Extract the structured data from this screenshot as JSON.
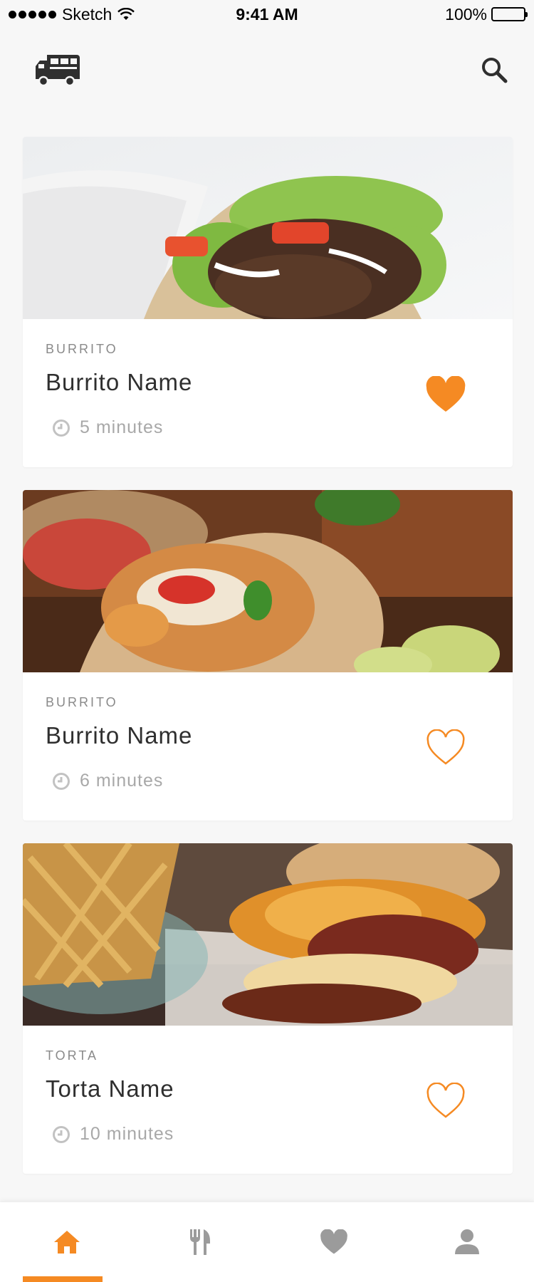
{
  "status_bar": {
    "carrier": "Sketch",
    "time": "9:41 AM",
    "battery": "100%"
  },
  "header": {
    "logo_icon": "food-truck-icon",
    "search_icon": "search-icon"
  },
  "colors": {
    "accent": "#f58a23",
    "tab_inactive": "#9b9b9b",
    "background": "#f7f7f7"
  },
  "cards": [
    {
      "category": "BURRITO",
      "title": "Burrito Name",
      "time": "5 minutes",
      "favorited": true
    },
    {
      "category": "BURRITO",
      "title": "Burrito Name",
      "time": "6 minutes",
      "favorited": false
    },
    {
      "category": "TORTA",
      "title": "Torta Name",
      "time": "10 minutes",
      "favorited": false
    }
  ],
  "tabbar": {
    "tabs": [
      {
        "icon": "home-icon",
        "active": true
      },
      {
        "icon": "fork-knife-icon",
        "active": false
      },
      {
        "icon": "heart-icon",
        "active": false
      },
      {
        "icon": "user-icon",
        "active": false
      }
    ]
  }
}
